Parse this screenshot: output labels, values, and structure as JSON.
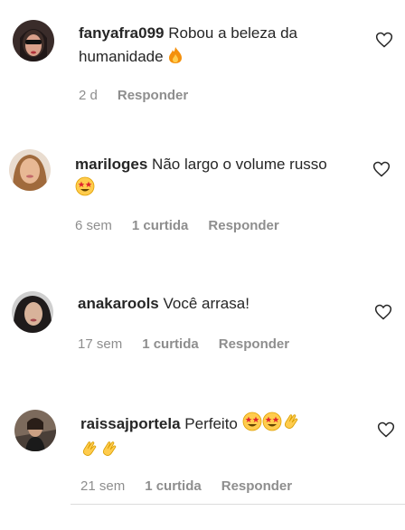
{
  "comments": [
    {
      "username": "fanyafra099",
      "text": "Robou a beleza da humanidade",
      "emoji": [
        "fire"
      ],
      "time": "2 d",
      "likes": "",
      "reply": "Responder"
    },
    {
      "username": "mariloges",
      "text": "Não largo o volume russo",
      "emoji": [
        "star-struck"
      ],
      "time": "6 sem",
      "likes": "1 curtida",
      "reply": "Responder"
    },
    {
      "username": "anakarools",
      "text": "Você arrasa!",
      "emoji": [],
      "time": "17 sem",
      "likes": "1 curtida",
      "reply": "Responder"
    },
    {
      "username": "raissajportela",
      "text": "Perfeito",
      "emoji": [
        "star-struck",
        "star-struck",
        "clapping-hands",
        "clapping-hands",
        "clapping-hands"
      ],
      "time": "21 sem",
      "likes": "1 curtida",
      "reply": "Responder"
    }
  ]
}
